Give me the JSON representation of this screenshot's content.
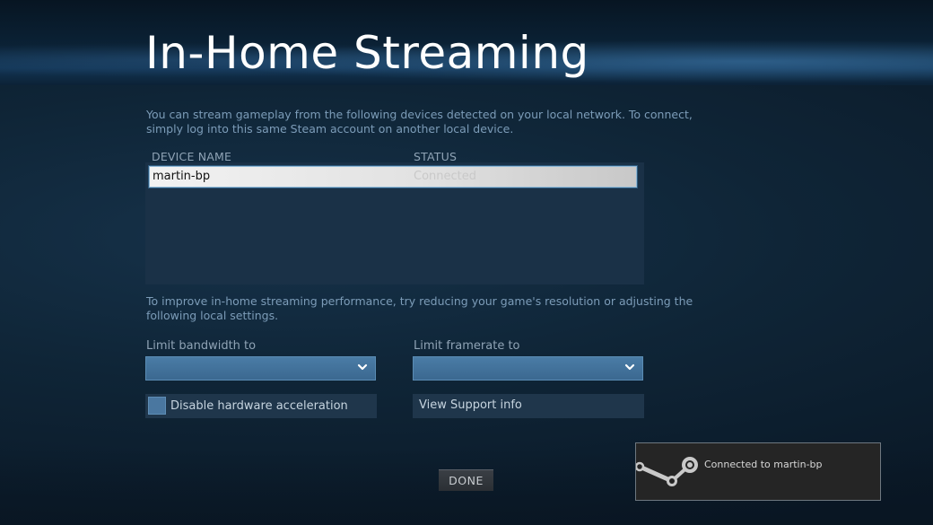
{
  "header": {
    "title": "In-Home Streaming"
  },
  "intro": {
    "text": "You can stream gameplay from the following devices detected on your local network. To connect, simply log into this same Steam account on another local device."
  },
  "device_table": {
    "columns": [
      "DEVICE NAME",
      "STATUS"
    ],
    "rows": [
      {
        "device_name": "martin-bp",
        "status": "Connected",
        "selected": true
      }
    ]
  },
  "performance_hint": {
    "text": "To improve in-home streaming performance, try reducing your game's resolution or adjusting the following local settings."
  },
  "settings": {
    "bandwidth_label": "Limit bandwidth to",
    "bandwidth_value": "",
    "framerate_label": "Limit framerate to",
    "framerate_value": "",
    "hw_accel_label": "Disable hardware acceleration",
    "hw_accel_checked": false,
    "support_label": "View Support info"
  },
  "footer": {
    "done_label": "DONE"
  },
  "toast": {
    "icon": "steam-logo-icon",
    "text": "Connected to martin-bp"
  },
  "colors": {
    "background": "#0f2537",
    "accent": "#4a7ca6",
    "text_muted": "#7c9cb8"
  }
}
